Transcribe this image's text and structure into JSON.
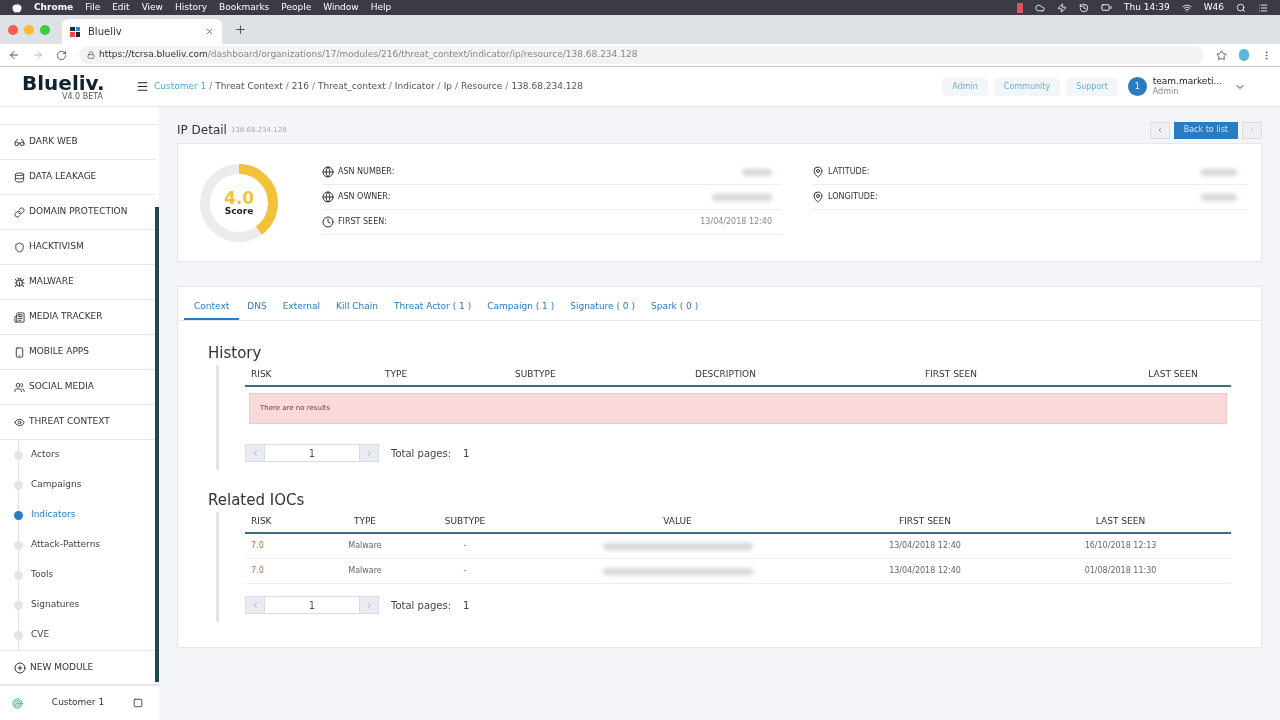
{
  "menubar": {
    "app": "Chrome",
    "menus": [
      "File",
      "Edit",
      "View",
      "History",
      "Bookmarks",
      "People",
      "Window",
      "Help"
    ],
    "clock": "Thu 14:39",
    "week": "W46"
  },
  "browser": {
    "tab_title": "Blueliv",
    "url_host": "https://tcrsa.blueliv.com",
    "url_path": "/dashboard/organizations/17/modules/216/threat_context/indicator/ip/resource/138.68.234.128"
  },
  "header": {
    "logo": "Blueliv.",
    "version": "V4.0 BETA",
    "breadcrumb_separator": "/",
    "breadcrumb": [
      "Customer 1",
      "Threat Context",
      "216",
      "Threat_context",
      "Indicator",
      "Ip",
      "Resource",
      "138.68.234.128"
    ],
    "buttons": [
      "Admin",
      "Community",
      "Support"
    ],
    "user": {
      "avatar": "1",
      "name": "team.marketi...",
      "role": "Admin"
    }
  },
  "sidebar": {
    "items": [
      {
        "label": "DARK WEB",
        "kind": "module"
      },
      {
        "label": "DATA LEAKAGE",
        "kind": "module"
      },
      {
        "label": "DOMAIN PROTECTION",
        "kind": "module"
      },
      {
        "label": "HACKTIVISM",
        "kind": "module"
      },
      {
        "label": "MALWARE",
        "kind": "module"
      },
      {
        "label": "MEDIA TRACKER",
        "kind": "module"
      },
      {
        "label": "MOBILE APPS",
        "kind": "module"
      },
      {
        "label": "SOCIAL MEDIA",
        "kind": "module"
      },
      {
        "label": "THREAT CONTEXT",
        "kind": "module",
        "children": [
          {
            "label": "Actors",
            "selected": false
          },
          {
            "label": "Campaigns",
            "selected": false
          },
          {
            "label": "Indicators",
            "selected": true
          },
          {
            "label": "Attack-Patterns",
            "selected": false
          },
          {
            "label": "Tools",
            "selected": false
          },
          {
            "label": "Signatures",
            "selected": false
          },
          {
            "label": "CVE",
            "selected": false
          }
        ]
      },
      {
        "label": "NEW MODULE",
        "kind": "add"
      }
    ],
    "footer": "Customer 1"
  },
  "page": {
    "title": "IP Detail",
    "subtitle": "138.68.234.128",
    "back_button": "Back to list",
    "score": {
      "value": "4.0",
      "label": "Score",
      "level": 0.4
    },
    "fields_left": [
      {
        "label": "ASN NUMBER:",
        "blurred": true
      },
      {
        "label": "ASN OWNER:",
        "blurred": true
      },
      {
        "label": "FIRST SEEN:",
        "blurred": false,
        "value": "13/04/2018 12:40"
      }
    ],
    "fields_right": [
      {
        "label": "LATITUDE:",
        "blurred": true
      },
      {
        "label": "LONGITUDE:",
        "blurred": true
      }
    ],
    "tabs": [
      {
        "label": "Context",
        "selected": true
      },
      {
        "label": "DNS",
        "selected": false
      },
      {
        "label": "External",
        "selected": false
      },
      {
        "label": "Kill Chain",
        "selected": false
      },
      {
        "label": "Threat Actor ( 1 )",
        "selected": false
      },
      {
        "label": "Campaign ( 1 )",
        "selected": false
      },
      {
        "label": "Signature ( 0 )",
        "selected": false
      },
      {
        "label": "Spark ( 0 )",
        "selected": false
      }
    ],
    "history": {
      "title": "History",
      "columns": [
        "RISK",
        "TYPE",
        "SUBTYPE",
        "DESCRIPTION",
        "FIRST SEEN",
        "LAST SEEN"
      ],
      "empty": "There are no results",
      "page": "1",
      "total_label": "Total pages:",
      "total": "1"
    },
    "iocs": {
      "title": "Related IOCs",
      "columns": [
        "RISK",
        "TYPE",
        "SUBTYPE",
        "VALUE",
        "FIRST SEEN",
        "LAST SEEN"
      ],
      "rows": [
        {
          "risk": "7.0",
          "type": "Malware",
          "subtype": "-",
          "blurred": true,
          "first_seen": "13/04/2018 12:40",
          "last_seen": "16/10/2018 12:13"
        },
        {
          "risk": "7.0",
          "type": "Malware",
          "subtype": "-",
          "blurred": true,
          "first_seen": "13/04/2018 12:40",
          "last_seen": "01/08/2018 11:30"
        }
      ],
      "page": "1",
      "total_label": "Total pages:",
      "total": "1"
    }
  }
}
